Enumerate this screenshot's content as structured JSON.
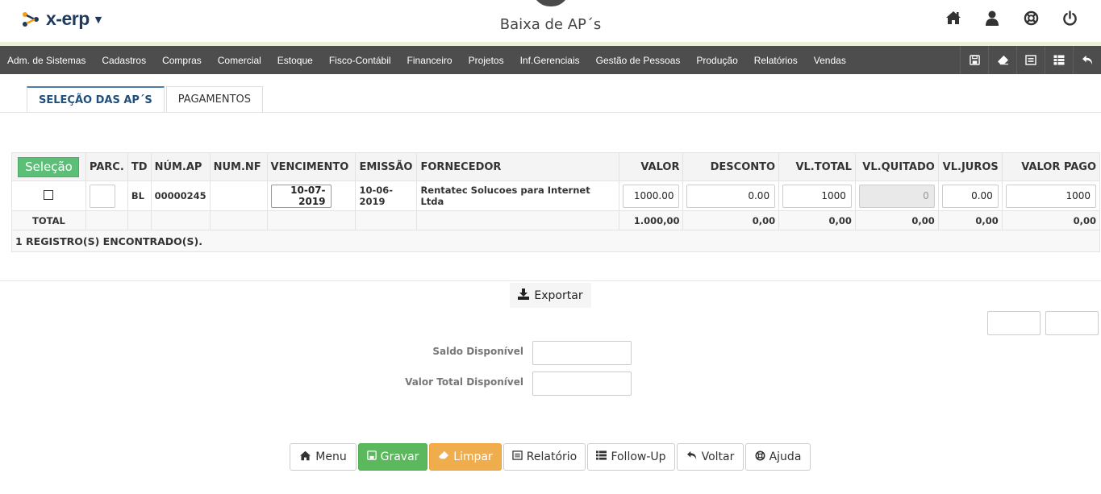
{
  "app": {
    "logo_text": "x-erp",
    "page_title": "Baixa de AP´s"
  },
  "top_icons": [
    "home-icon",
    "user-icon",
    "lifebuoy-icon",
    "power-icon"
  ],
  "menu": {
    "items": [
      "Adm. de Sistemas",
      "Cadastros",
      "Compras",
      "Comercial",
      "Estoque",
      "Fisco-Contábil",
      "Financeiro",
      "Projetos",
      "Inf.Gerenciais",
      "Gestão de Pessoas",
      "Produção",
      "Relatórios",
      "Vendas"
    ],
    "tools": [
      "save-icon",
      "eraser-icon",
      "report-icon",
      "table-icon",
      "undo-icon"
    ]
  },
  "tabs": [
    {
      "label": "SELEÇÃO DAS AP´S",
      "active": true
    },
    {
      "label": "PAGAMENTOS",
      "active": false
    }
  ],
  "table": {
    "selection_button": "Seleção",
    "headers": {
      "parc": "PARC.",
      "td": "TD",
      "num_ap": "NÚM.AP",
      "num_nf": "NUM.NF",
      "vencimento": "VENCIMENTO",
      "emissao": "EMISSÃO",
      "fornecedor": "FORNECEDOR",
      "valor": "VALOR",
      "desconto": "DESCONTO",
      "vl_total": "VL.TOTAL",
      "vl_quitado": "VL.QUITADO",
      "vl_juros": "VL.JUROS",
      "valor_pago": "VALOR PAGO"
    },
    "row": {
      "parc": "",
      "td": "BL",
      "num_ap": "00000245",
      "num_nf": "",
      "vencimento": "10-07-2019",
      "emissao": "10-06-2019",
      "fornecedor": "Rentatec Solucoes para Internet Ltda",
      "valor": "1000.00",
      "desconto": "0.00",
      "vl_total": "1000",
      "vl_quitado": "0",
      "vl_juros": "0.00",
      "valor_pago": "1000"
    },
    "total": {
      "label": "TOTAL",
      "valor": "1.000,00",
      "desconto": "0,00",
      "vl_total": "0,00",
      "vl_quitado": "0,00",
      "vl_juros": "0,00",
      "valor_pago": "0,00"
    },
    "found_text": "1 REGISTRO(S) ENCONTRADO(S)."
  },
  "export_label": "Exportar",
  "fields": {
    "saldo_label": "Saldo Disponível",
    "saldo_value": "",
    "valor_total_label": "Valor Total Disponível",
    "valor_total_value": ""
  },
  "actions": {
    "menu": "Menu",
    "gravar": "Gravar",
    "limpar": "Limpar",
    "relatorio": "Relatório",
    "follow_up": "Follow-Up",
    "voltar": "Voltar",
    "ajuda": "Ajuda"
  },
  "colors": {
    "menubar": "#4d4d4d",
    "green": "#5cb85c",
    "orange": "#f0ad4e",
    "tab_accent": "#4e7ea6"
  }
}
